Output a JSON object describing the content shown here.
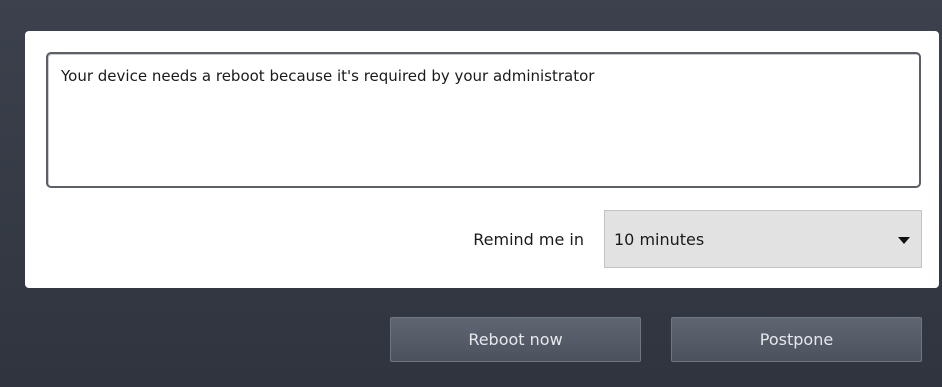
{
  "message": {
    "text": "Your device needs a reboot because it's required by your administrator"
  },
  "remind": {
    "label": "Remind me in",
    "selected": "10 minutes",
    "dropdown_icon": "triangle-down"
  },
  "buttons": {
    "reboot_label": "Reboot now",
    "postpone_label": "Postpone"
  },
  "colors": {
    "background": "#353a45",
    "panel": "#ffffff",
    "button": "#555c68",
    "button_text": "#e6e8ec",
    "select_background": "#e2e2e2"
  }
}
